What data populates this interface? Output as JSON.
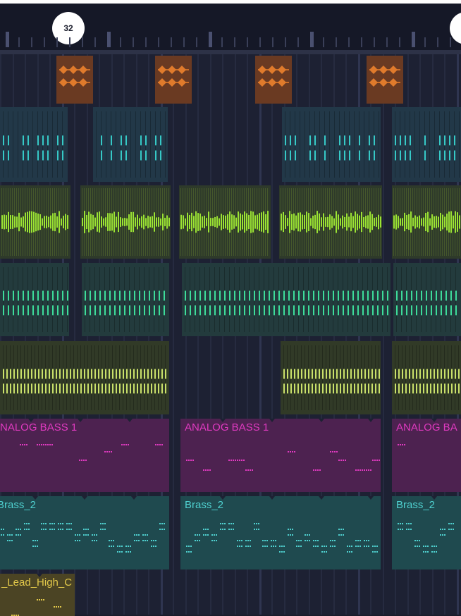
{
  "timeline": {
    "markers": [
      {
        "label": "32",
        "id": "marker-32"
      },
      {
        "label": "",
        "id": "marker-next"
      }
    ]
  },
  "tracks": [
    {
      "id": "track-hat",
      "kind": "orange-hits",
      "color": "#e07b2c",
      "bg": "#6a3a22",
      "clips": [
        {
          "name": ""
        },
        {
          "name": ""
        },
        {
          "name": ""
        },
        {
          "name": ""
        }
      ]
    },
    {
      "id": "track-perc",
      "kind": "teal-hits",
      "color": "#36c9c6",
      "bg": "#223848",
      "clips": [
        {
          "name": ""
        },
        {
          "name": ""
        },
        {
          "name": ""
        },
        {
          "name": ""
        }
      ]
    },
    {
      "id": "track-green",
      "kind": "green-dense",
      "color": "#9be333",
      "bg": "#2e3a2a",
      "clips": [
        {
          "name": ""
        },
        {
          "name": ""
        },
        {
          "name": ""
        },
        {
          "name": ""
        },
        {
          "name": ""
        }
      ]
    },
    {
      "id": "track-mint",
      "kind": "mint-hits",
      "color": "#3ddc9a",
      "bg": "#233b3d",
      "clips": [
        {
          "name": ""
        },
        {
          "name": ""
        },
        {
          "name": ""
        },
        {
          "name": ""
        }
      ]
    },
    {
      "id": "track-olive",
      "kind": "olive-hits",
      "color": "#c9e06a",
      "bg": "#313a27",
      "clips": [
        {
          "name": ""
        },
        {
          "name": ""
        },
        {
          "name": ""
        }
      ]
    },
    {
      "id": "track-bass",
      "kind": "pattern",
      "color": "#e03ac0",
      "bg": "#4d2250",
      "clips": [
        {
          "name": "ANALOG BASS 1"
        },
        {
          "name": "ANALOG BASS 1"
        },
        {
          "name": "ANALOG BA"
        }
      ]
    },
    {
      "id": "track-brass",
      "kind": "pattern",
      "color": "#4fd0cf",
      "bg": "#1f4a4f",
      "clips": [
        {
          "name": "Brass_2"
        },
        {
          "name": "Brass_2"
        },
        {
          "name": "Brass_2"
        }
      ]
    },
    {
      "id": "track-lead",
      "kind": "pattern",
      "color": "#e2c84a",
      "bg": "#4b4424",
      "clips": [
        {
          "name": "_Lead_High_C"
        }
      ]
    }
  ]
}
